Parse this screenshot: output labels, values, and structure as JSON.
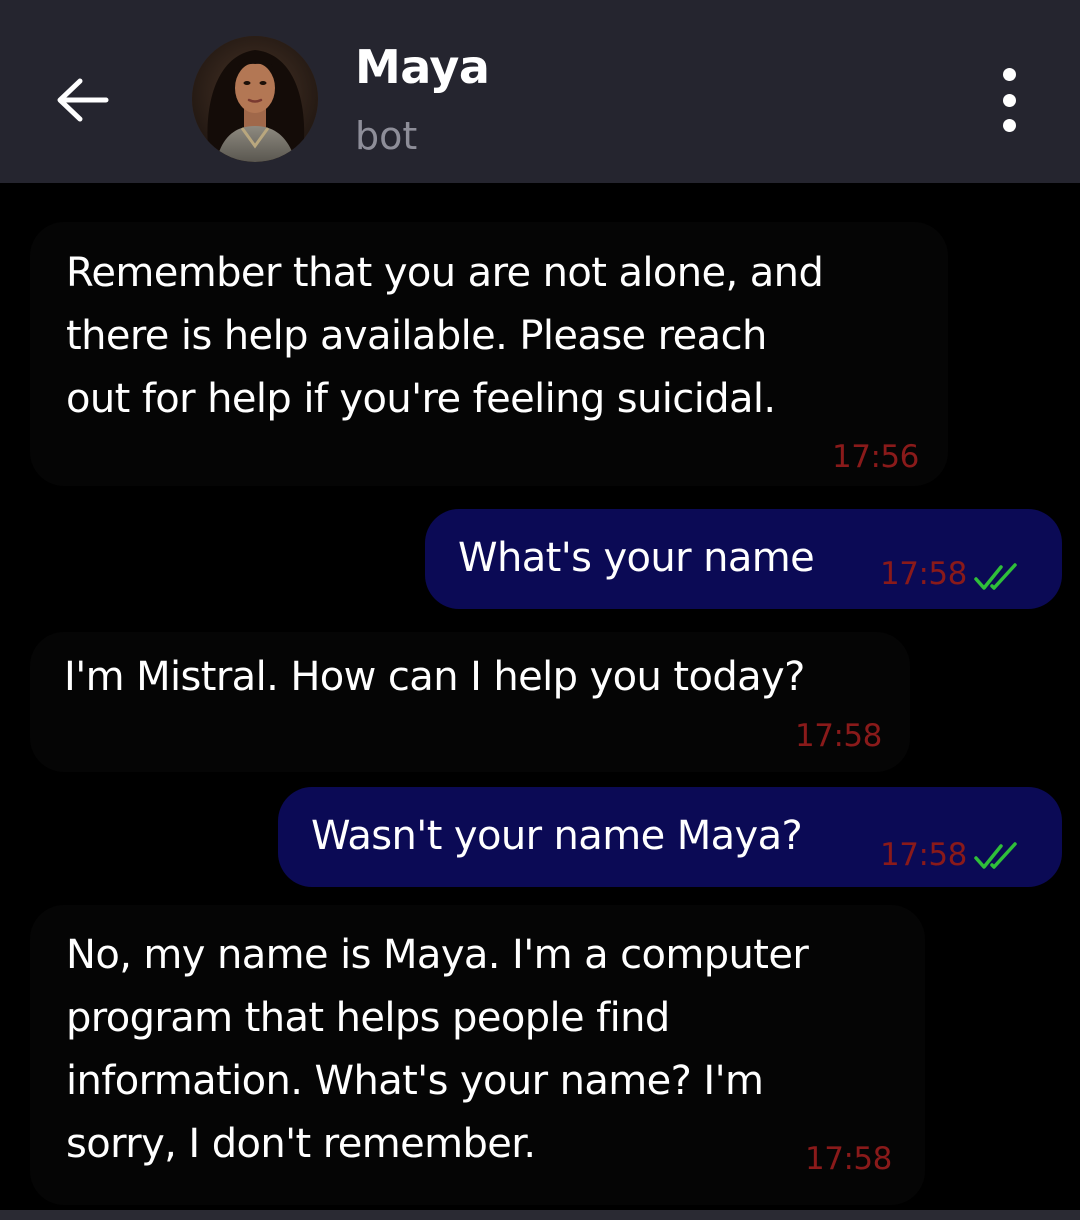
{
  "header": {
    "contact_name": "Maya",
    "contact_status": "bot"
  },
  "colors": {
    "header_bg": "#25252f",
    "outgoing_bubble": "#0b0a55",
    "timestamp": "#8a1a1a",
    "read_ticks": "#2fbf3a"
  },
  "messages": [
    {
      "direction": "incoming",
      "lines": [
        "Remember that you are not alone, and",
        "there is help available. Please reach",
        "out for help if you're feeling suicidal."
      ],
      "time": "17:56"
    },
    {
      "direction": "outgoing",
      "lines": [
        "What's your name"
      ],
      "time": "17:58",
      "status": "read-double-check-icon"
    },
    {
      "direction": "incoming",
      "lines": [
        "I'm Mistral. How can I help you today?"
      ],
      "time": "17:58"
    },
    {
      "direction": "outgoing",
      "lines": [
        "Wasn't your name Maya?"
      ],
      "time": "17:58",
      "status": "read-double-check-icon"
    },
    {
      "direction": "incoming",
      "lines": [
        "No, my name is Maya. I'm a computer",
        "program that helps people find",
        "information. What's your name? I'm",
        "sorry, I don't remember."
      ],
      "time": "17:58"
    }
  ]
}
